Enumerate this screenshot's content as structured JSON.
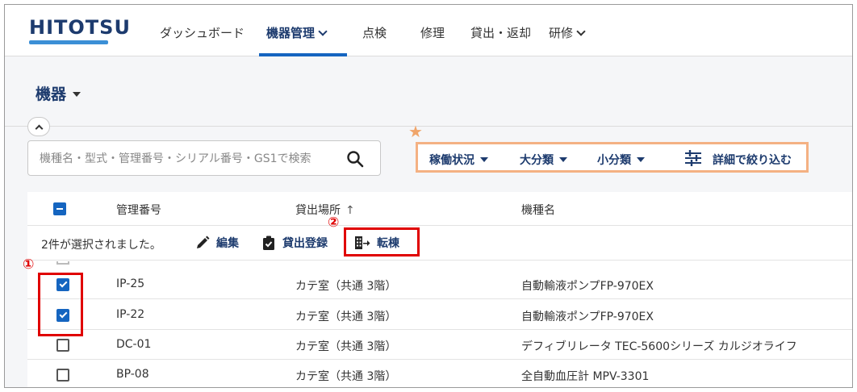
{
  "header": {
    "logo": "HITOTSU",
    "nav": [
      {
        "label": "ダッシュボード",
        "dropdown": false,
        "active": false
      },
      {
        "label": "機器管理",
        "dropdown": true,
        "active": true
      },
      {
        "label": "点検",
        "dropdown": false,
        "active": false
      },
      {
        "label": "修理",
        "dropdown": false,
        "active": false
      },
      {
        "label": "貸出・返却",
        "dropdown": false,
        "active": false
      },
      {
        "label": "研修",
        "dropdown": true,
        "active": false
      }
    ]
  },
  "page": {
    "title": "機器"
  },
  "search": {
    "placeholder": "機種名・型式・管理番号・シリアル番号・GS1で検索"
  },
  "filters": {
    "marker": "★",
    "items": [
      "稼働状況",
      "大分類",
      "小分類"
    ],
    "advanced": "詳細で絞り込む"
  },
  "table": {
    "headers": [
      "管理番号",
      "貸出場所",
      "機種名"
    ],
    "sort_indicator": "↑",
    "selection_text": "2件が選択されました。",
    "actions": [
      "編集",
      "貸出登録",
      "転棟"
    ],
    "rows": [
      {
        "id": "IP-25",
        "location": "カテ室（共通 3階）",
        "model": "自動輸液ポンプFP-970EX",
        "checked": true
      },
      {
        "id": "IP-22",
        "location": "カテ室（共通 3階）",
        "model": "自動輸液ポンプFP-970EX",
        "checked": true
      },
      {
        "id": "DC-01",
        "location": "カテ室（共通 3階）",
        "model": "デフィブリレータ TEC-5600シリーズ カルジオライフ",
        "checked": false
      },
      {
        "id": "BP-08",
        "location": "カテ室（共通 3階）",
        "model": "全自動血圧計 MPV-3301",
        "checked": false
      }
    ]
  },
  "annotations": {
    "marker1": "①",
    "marker2": "②"
  },
  "colors": {
    "brand": "#1d3b6e",
    "accent": "#1565c0",
    "highlight": "#e00000",
    "filter_border": "#f4b183"
  }
}
